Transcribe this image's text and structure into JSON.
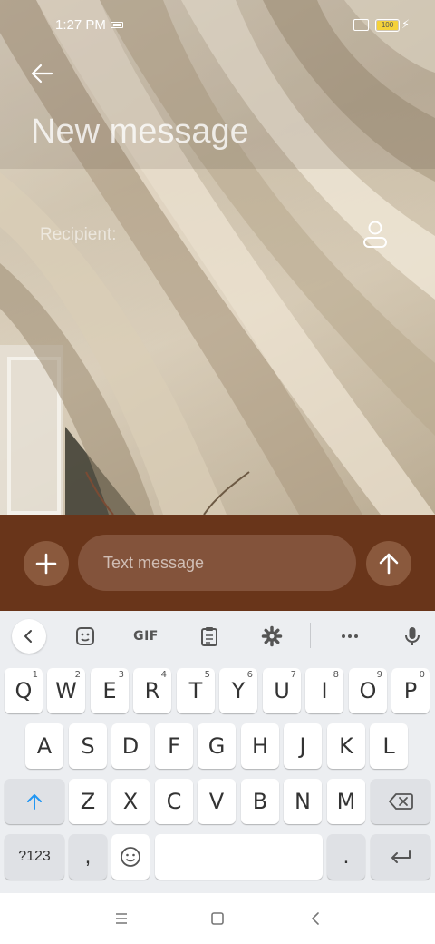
{
  "status_bar": {
    "time": "1:27 PM",
    "battery_text": "100"
  },
  "header": {
    "title": "New message",
    "back_icon": "arrow-left-icon"
  },
  "recipient": {
    "placeholder": "Recipient:",
    "contact_icon": "person-icon"
  },
  "compose": {
    "placeholder": "Text message",
    "attach_icon": "plus-icon",
    "send_icon": "arrow-up-icon",
    "bar_color": "#69351a",
    "field_color": "#83533b"
  },
  "keyboard": {
    "toolbar": {
      "gif_label": "GIF",
      "items": [
        "chevron-left-icon",
        "sticker-icon",
        "gif-icon",
        "clipboard-icon",
        "gear-icon",
        "more-icon",
        "mic-icon"
      ]
    },
    "rows": {
      "row1": [
        {
          "label": "Q",
          "hint": "1"
        },
        {
          "label": "W",
          "hint": "2"
        },
        {
          "label": "E",
          "hint": "3"
        },
        {
          "label": "R",
          "hint": "4"
        },
        {
          "label": "T",
          "hint": "5"
        },
        {
          "label": "Y",
          "hint": "6"
        },
        {
          "label": "U",
          "hint": "7"
        },
        {
          "label": "I",
          "hint": "8"
        },
        {
          "label": "O",
          "hint": "9"
        },
        {
          "label": "P",
          "hint": "0"
        }
      ],
      "row2": [
        "A",
        "S",
        "D",
        "F",
        "G",
        "H",
        "J",
        "K",
        "L"
      ],
      "row3": [
        "Z",
        "X",
        "C",
        "V",
        "B",
        "N",
        "M"
      ],
      "row4": {
        "symbols": "?123",
        "comma": ",",
        "period": "."
      }
    },
    "accent_color": "#2196f3"
  },
  "nav_bar": {
    "items": [
      "menu-icon",
      "home-square-icon",
      "back-chevron-icon"
    ]
  }
}
